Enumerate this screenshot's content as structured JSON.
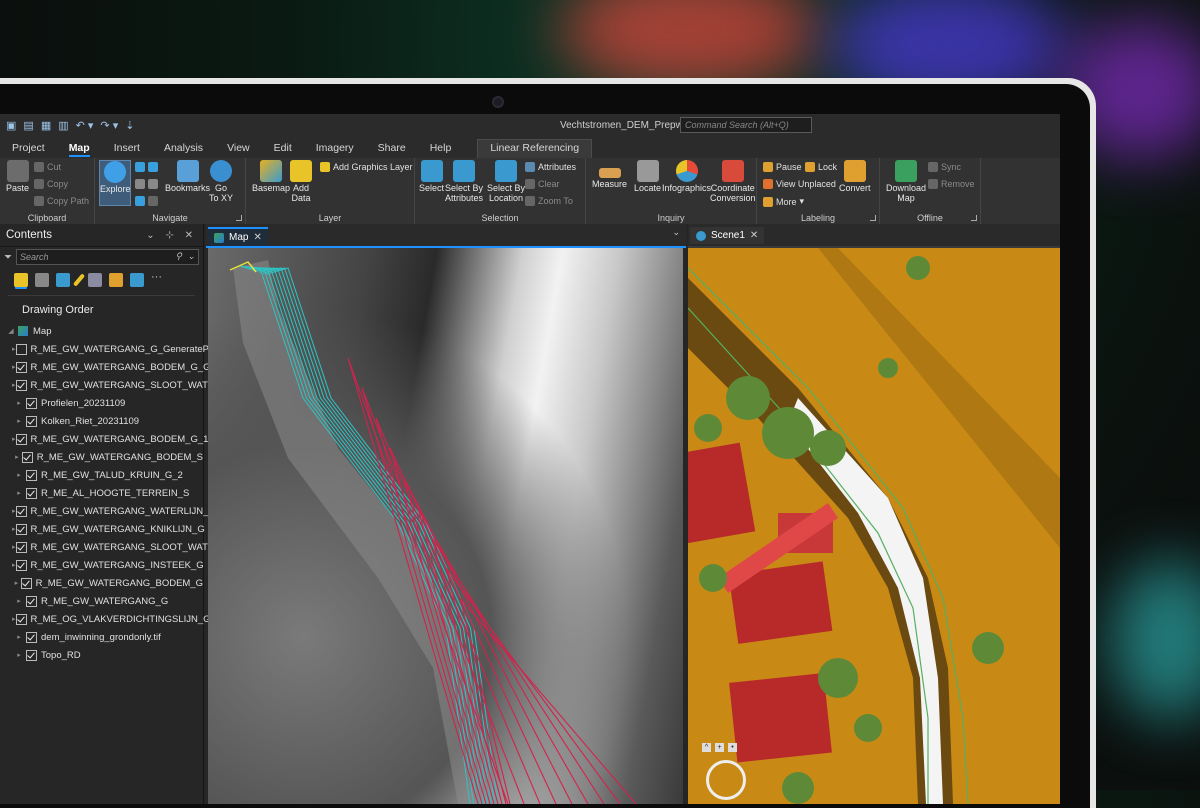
{
  "app": {
    "document_title": "Vechtstromen_DEM_Prepwork",
    "command_search_placeholder": "Command Search (Alt+Q)"
  },
  "menu_tabs": [
    "Project",
    "Map",
    "Insert",
    "Analysis",
    "View",
    "Edit",
    "Imagery",
    "Share",
    "Help"
  ],
  "active_tab": "Map",
  "context_tab": "Linear Referencing",
  "ribbon": {
    "clipboard": {
      "label": "Clipboard",
      "paste": "Paste",
      "cut": "Cut",
      "copy": "Copy",
      "copy_path": "Copy Path"
    },
    "navigate": {
      "label": "Navigate",
      "explore": "Explore",
      "bookmarks": "Bookmarks",
      "go_to": "Go",
      "go_to2": "To XY"
    },
    "layer": {
      "label": "Layer",
      "basemap": "Basemap",
      "add_data": "Add",
      "add_data2": "Data",
      "add_graphics": "Add Graphics Layer"
    },
    "selection": {
      "label": "Selection",
      "select": "Select",
      "select_by_attr": "Select By",
      "select_by_attr2": "Attributes",
      "select_by_loc": "Select By",
      "select_by_loc2": "Location",
      "attributes": "Attributes",
      "clear": "Clear",
      "zoom_to": "Zoom To"
    },
    "inquiry": {
      "label": "Inquiry",
      "measure": "Measure",
      "locate": "Locate",
      "infographics": "Infographics",
      "coord": "Coordinate",
      "coord2": "Conversion"
    },
    "labeling": {
      "label": "Labeling",
      "pause": "Pause",
      "lock": "Lock",
      "view_unplaced": "View Unplaced",
      "more": "More",
      "convert": "Convert"
    },
    "offline": {
      "label": "Offline",
      "download": "Download",
      "download2": "Map",
      "sync": "Sync",
      "remove": "Remove"
    }
  },
  "contents": {
    "title": "Contents",
    "search_placeholder": "Search",
    "drawing_order": "Drawing Order",
    "map_name": "Map",
    "layers": [
      {
        "name": "R_ME_GW_WATERGANG_G_GeneratePoi...",
        "checked": false
      },
      {
        "name": "R_ME_GW_WATERGANG_BODEM_G_Gene...",
        "checked": true
      },
      {
        "name": "R_ME_GW_WATERGANG_SLOOT_WATERLI...",
        "checked": true
      },
      {
        "name": "Profielen_20231109",
        "checked": true
      },
      {
        "name": "Kolken_Riet_20231109",
        "checked": true
      },
      {
        "name": "R_ME_GW_WATERGANG_BODEM_G_1",
        "checked": true
      },
      {
        "name": "R_ME_GW_WATERGANG_BODEM_S",
        "checked": true
      },
      {
        "name": "R_ME_GW_TALUD_KRUIN_G_2",
        "checked": true
      },
      {
        "name": "R_ME_AL_HOOGTE_TERREIN_S",
        "checked": true
      },
      {
        "name": "R_ME_GW_WATERGANG_WATERLIJN_G",
        "checked": true
      },
      {
        "name": "R_ME_GW_WATERGANG_KNIKLIJN_G",
        "checked": true
      },
      {
        "name": "R_ME_GW_WATERGANG_SLOOT_WATERLI...",
        "checked": true
      },
      {
        "name": "R_ME_GW_WATERGANG_INSTEEK_G",
        "checked": true
      },
      {
        "name": "R_ME_GW_WATERGANG_BODEM_G",
        "checked": true
      },
      {
        "name": "R_ME_GW_WATERGANG_G",
        "checked": true
      },
      {
        "name": "R_ME_OG_VLAKVERDICHTINGSLIJN_G",
        "checked": true
      },
      {
        "name": "dem_inwinning_grondonly.tif",
        "checked": true
      },
      {
        "name": "Topo_RD",
        "checked": true
      }
    ]
  },
  "views": {
    "map_tab": "Map",
    "scene_tab": "Scene1"
  },
  "colors": {
    "accent": "#1e90ff",
    "outline_cyan": "#2ec4c4",
    "outline_red": "#d2234d",
    "outline_yellow": "#e8e23a"
  }
}
